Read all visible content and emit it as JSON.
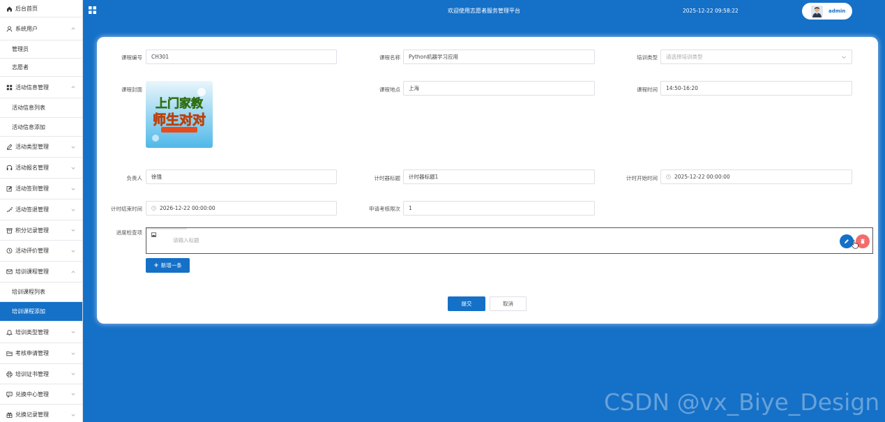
{
  "sidebar": {
    "items": [
      {
        "label": "后台首页",
        "icon": "home-icon"
      },
      {
        "label": "系统用户",
        "icon": "user-icon",
        "chevron": "up"
      },
      {
        "label": "管理员",
        "sub": true
      },
      {
        "label": "志愿者",
        "sub": true
      },
      {
        "label": "活动信息管理",
        "icon": "grid-icon",
        "chevron": "up"
      },
      {
        "label": "活动信息列表",
        "sub": true
      },
      {
        "label": "活动信息添加",
        "sub": true
      },
      {
        "label": "活动类型管理",
        "icon": "pen-icon",
        "chevron": "down"
      },
      {
        "label": "活动报名管理",
        "icon": "headset-icon",
        "chevron": "down"
      },
      {
        "label": "活动签到管理",
        "icon": "edit-icon",
        "chevron": "down"
      },
      {
        "label": "活动签退管理",
        "icon": "signal-icon",
        "chevron": "down"
      },
      {
        "label": "积分记录管理",
        "icon": "box-icon",
        "chevron": "down"
      },
      {
        "label": "活动评价管理",
        "icon": "clock-icon",
        "chevron": "down"
      },
      {
        "label": "培训课程管理",
        "icon": "mail-icon",
        "chevron": "up"
      },
      {
        "label": "培训课程列表",
        "sub": true
      },
      {
        "label": "培训课程添加",
        "sub": true,
        "active": true
      },
      {
        "label": "培训类型管理",
        "icon": "bell-icon",
        "chevron": "down"
      },
      {
        "label": "考核申请管理",
        "icon": "folder-icon",
        "chevron": "down"
      },
      {
        "label": "培训证书管理",
        "icon": "printer-icon",
        "chevron": "down"
      },
      {
        "label": "兑换中心管理",
        "icon": "message-icon",
        "chevron": "down"
      },
      {
        "label": "兑换记录管理",
        "icon": "gift-icon",
        "chevron": "down"
      }
    ]
  },
  "header": {
    "title": "欢迎使用志愿者服务管理平台",
    "datetime": "2025-12-22 09:58:22",
    "username": "admin"
  },
  "form": {
    "course_no_label": "课程编号",
    "course_no_value": "CH301",
    "course_name_label": "课程名称",
    "course_name_value": "Python机器学习应用",
    "training_type_label": "培训类型",
    "training_type_placeholder": "请选择培训类型",
    "cover_label": "课程封面",
    "cover_image_text": "上门家教",
    "cover_image_text2": "师生对对",
    "location_label": "课程地点",
    "location_value": "上海",
    "time_label": "课程时间",
    "time_value": "14:50-16:20",
    "leader_label": "负责人",
    "leader_value": "徐强",
    "timer_title_label": "计时器标题",
    "timer_title_value": "计时器标题1",
    "timer_start_label": "计时开始时间",
    "timer_start_value": "2025-12-22 00:00:00",
    "timer_end_label": "计时结束时间",
    "timer_end_value": "2026-12-22 00:00:00",
    "exam_times_label": "申请考核限次",
    "exam_times_value": "1",
    "progress_label": "进度检查项",
    "editor_placeholder": "请输入标题",
    "add_button": "新增一条",
    "submit_button": "提交",
    "cancel_button": "取消"
  },
  "watermark": "CSDN @vx_Biye_Design",
  "colors": {
    "primary": "#1570c7",
    "danger": "#f36c6c"
  }
}
